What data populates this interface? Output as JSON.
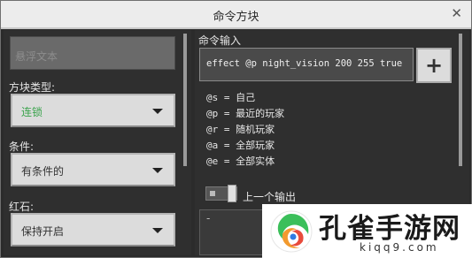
{
  "window": {
    "title": "命令方块",
    "close_glyph": "✕"
  },
  "left_panel": {
    "hover_text_placeholder": "悬浮文本",
    "block_type": {
      "label": "方块类型:",
      "value": "连锁"
    },
    "condition": {
      "label": "条件:",
      "value": "有条件的"
    },
    "redstone": {
      "label": "红石:",
      "value": "保持开启"
    }
  },
  "right_panel": {
    "command_label": "命令输入",
    "command_value": "effect @p night_vision 200 255 true",
    "add_button": "+",
    "selectors": [
      "@s = 自己",
      "@p = 最近的玩家",
      "@r = 随机玩家",
      "@a = 全部玩家",
      "@e = 全部实体"
    ],
    "previous_output_label": "上一个输出",
    "output_value": "-"
  },
  "watermark": {
    "name": "孔雀手游网",
    "url": "kiqq9.com"
  },
  "colors": {
    "accent_green": "#3aa34c",
    "panel_bg": "#2f2f2f",
    "titlebar": "#ececec"
  }
}
